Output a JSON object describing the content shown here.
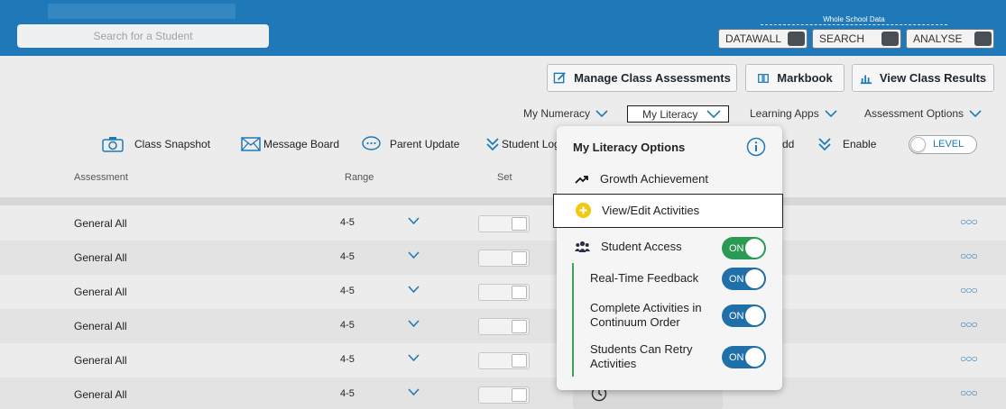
{
  "header": {
    "search_placeholder": "Search for a Student",
    "whole_school_label": "Whole School Data",
    "buttons": [
      "DATAWALL",
      "SEARCH",
      "ANALYSE"
    ]
  },
  "toolbar": {
    "manage": "Manage Class Assessments",
    "markbook": "Markbook",
    "results": "View Class Results"
  },
  "nav": {
    "numeracy": "My Numeracy",
    "literacy": "My Literacy",
    "apps": "Learning Apps",
    "options": "Assessment Options"
  },
  "actions": {
    "snapshot": "Class Snapshot",
    "message": "Message Board",
    "parent": "Parent Update",
    "student_log": "Student Log",
    "add": "dd",
    "enable": "Enable",
    "level": "LEVEL"
  },
  "table": {
    "headers": [
      "Assessment",
      "Range",
      "Set"
    ],
    "rows": [
      {
        "assessment": "General All",
        "range": "4-5"
      },
      {
        "assessment": "General All",
        "range": "4-5"
      },
      {
        "assessment": "General All",
        "range": "4-5"
      },
      {
        "assessment": "General All",
        "range": "4-5"
      },
      {
        "assessment": "General All",
        "range": "4-5"
      },
      {
        "assessment": "General All",
        "range": "4-5"
      }
    ]
  },
  "popup": {
    "title": "My Literacy Options",
    "growth": "Growth Achievement",
    "view_edit": "View/Edit Activities",
    "student_access": "Student Access",
    "realtime": "Real-Time Feedback",
    "complete_line1": "Complete Activities in",
    "complete_line2": "Continuum Order",
    "retry_line1": "Students Can Retry",
    "retry_line2": "Activities",
    "on_label": "ON"
  },
  "colors": {
    "brand": "#1f79b8",
    "toggle_green": "#2a9a55",
    "toggle_blue": "#1f6fa8",
    "plus_yellow": "#f2c811"
  }
}
